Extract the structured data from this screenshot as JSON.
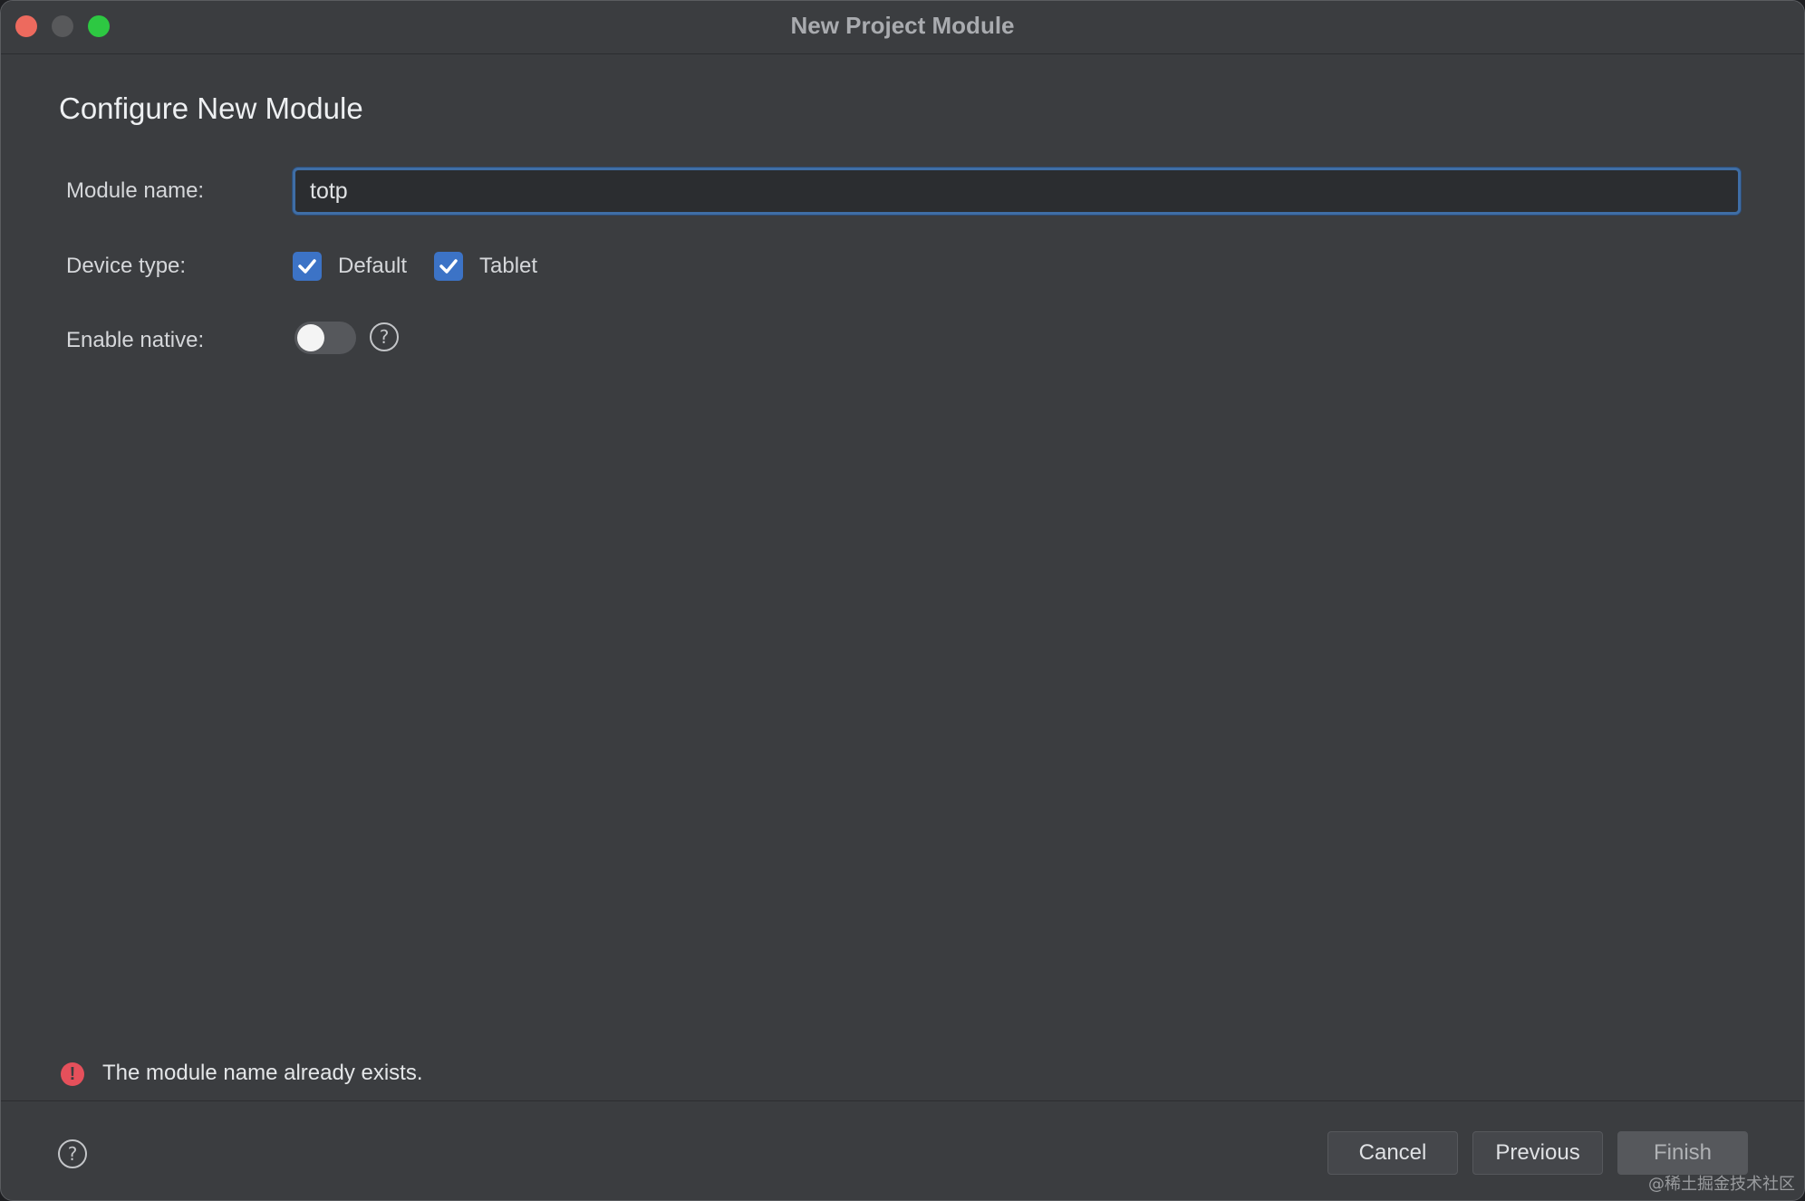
{
  "window": {
    "title": "New Project Module"
  },
  "page": {
    "title": "Configure New Module"
  },
  "form": {
    "module_name_label": "Module name:",
    "module_name_value": "totp",
    "device_type_label": "Device type:",
    "device_types": [
      {
        "label": "Default",
        "checked": true
      },
      {
        "label": "Tablet",
        "checked": true
      }
    ],
    "enable_native_label": "Enable native:",
    "enable_native": false,
    "enable_native_help": "?"
  },
  "status": {
    "error_icon": "!",
    "error_message": "The module name already exists."
  },
  "footer": {
    "help": "?",
    "cancel_label": "Cancel",
    "previous_label": "Previous",
    "finish_label": "Finish"
  },
  "watermark": "@稀土掘金技术社区",
  "colors": {
    "background": "#3b3d40",
    "accent": "#3c73c6",
    "error": "#e5505b",
    "close": "#ed6a5e",
    "maximize": "#2dc842"
  },
  "icons": {
    "checkbox": "checkmark-icon",
    "help": "question-circle-icon",
    "error": "error-circle-icon"
  }
}
